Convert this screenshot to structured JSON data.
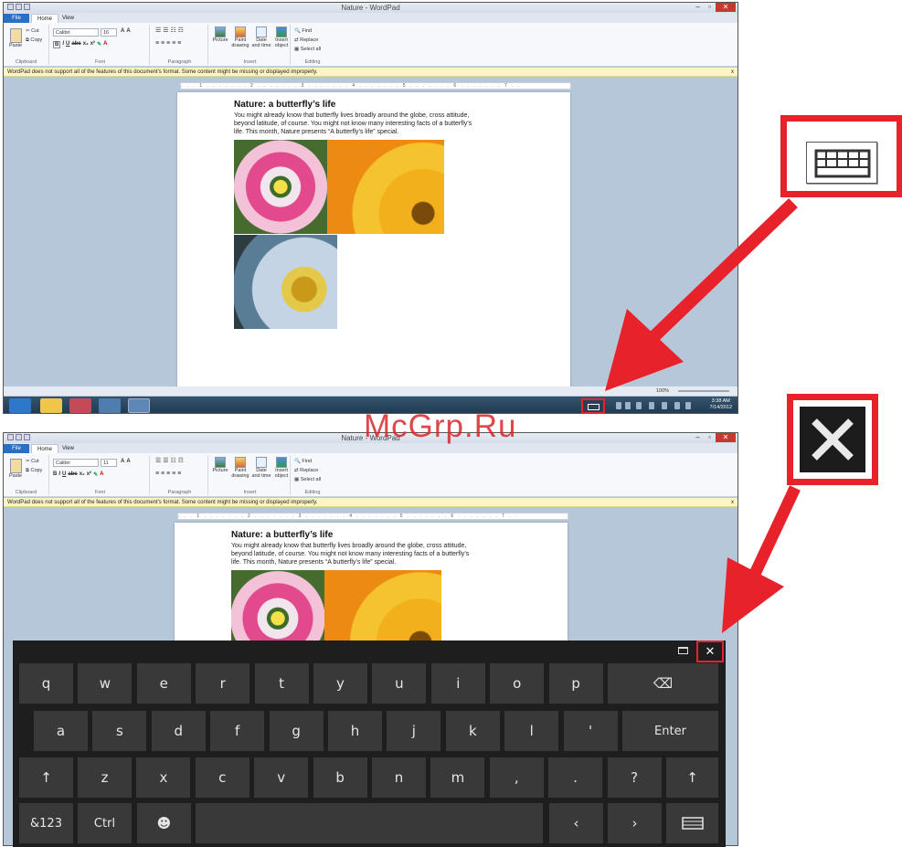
{
  "watermark": "McGrp.Ru",
  "app": {
    "title": "Nature - WordPad",
    "tabs": [
      "File",
      "Home",
      "View"
    ],
    "clipboard": {
      "paste": "Paste",
      "cut": "Cut",
      "copy": "Copy",
      "group": "Clipboard"
    },
    "font": {
      "family": "Calibri",
      "size_top": "16",
      "size_bottom": "11",
      "group": "Font"
    },
    "paragraph": {
      "group": "Paragraph"
    },
    "insert": {
      "picture": "Picture",
      "paint": "Paint drawing",
      "datetime": "Date and time",
      "object": "Insert object",
      "group": "Insert"
    },
    "editing": {
      "find": "Find",
      "replace": "Replace",
      "select_all": "Select all",
      "group": "Editing"
    },
    "info_bar": "WordPad does not support all of the features of this document's format. Some content might be missing or displayed improperly.",
    "info_close": "x",
    "ruler": ". . . 1 . . . . . . . 2 . . . . . . . 3 . . . . . . . 4 . . . . . . . 5 . . . . . . . 6 . . . . . . . 7 . .",
    "zoom": "100%",
    "time": "3:38 AM",
    "date": "7/14/2012"
  },
  "document": {
    "title": "Nature: a butterfly’s life",
    "line1": "You might already know that butterfly lives broadly around the globe, cross attitude,",
    "line2": "beyond latitude, of course. You might not know many interesting facts of a butterfly’s",
    "line3": "life. This month, Nature presents “A butterfly’s life” special."
  },
  "keyboard": {
    "close": "✕",
    "row1": [
      "q",
      "w",
      "e",
      "r",
      "t",
      "y",
      "u",
      "i",
      "o",
      "p"
    ],
    "row2": [
      "a",
      "s",
      "d",
      "f",
      "g",
      "h",
      "j",
      "k",
      "l",
      "'"
    ],
    "enter": "Enter",
    "row3": [
      "z",
      "x",
      "c",
      "v",
      "b",
      "n",
      "m",
      ",",
      ".",
      "?"
    ],
    "shift": "↑",
    "sym": "&123",
    "ctrl": "Ctrl",
    "emoji": "☻",
    "left": "‹",
    "right": "›",
    "backspace": "⌫"
  },
  "colors": {
    "accent": "#e8222a",
    "keyboard_bg": "#1f1e1e",
    "key_bg": "#3a3939"
  }
}
